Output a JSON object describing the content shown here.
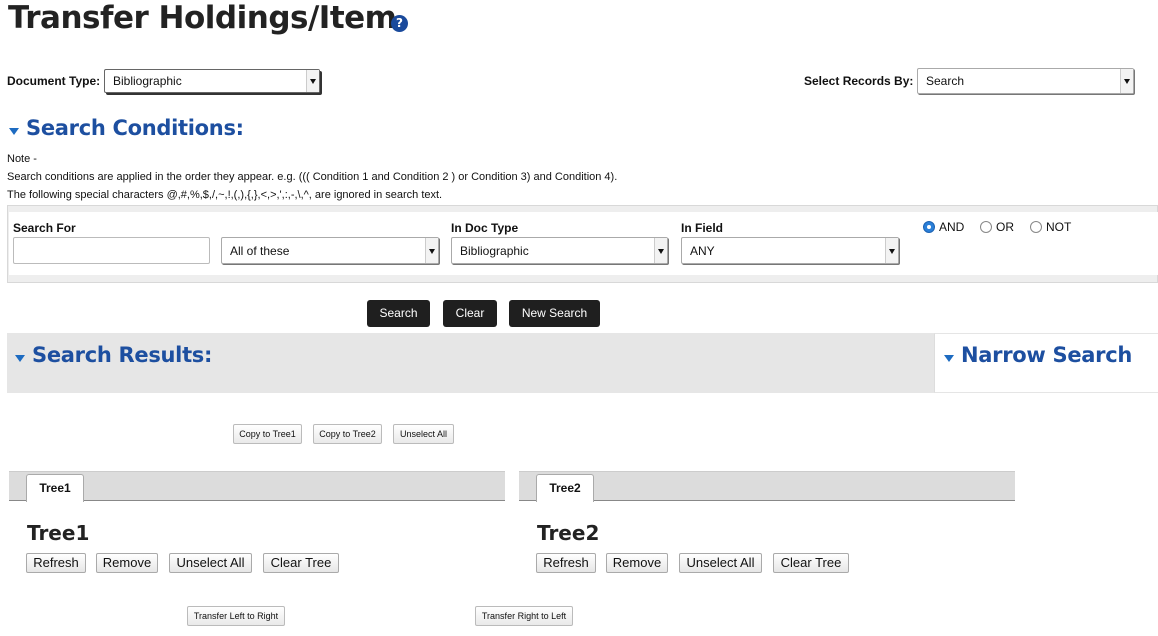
{
  "header": {
    "title": "Transfer Holdings/Item",
    "help_icon": "?"
  },
  "filters": {
    "document_type_label": "Document Type:",
    "document_type_value": "Bibliographic",
    "select_records_label": "Select Records By:",
    "select_records_value": "Search"
  },
  "search_conditions": {
    "title": "Search Conditions:",
    "note_heading": "Note -",
    "note_line1": "Search conditions are applied in the order they appear. e.g. ((( Condition 1 and Condition 2 ) or Condition 3) and Condition 4).",
    "note_line2": "The following special characters @,#,%,$,/,~,!,(,),{,},<,>,',:,-,\\,^, are ignored in search text.",
    "search_for_label": "Search For",
    "search_for_value": "",
    "match_value": "All of these",
    "doc_type_label": "In Doc Type",
    "doc_type_value": "Bibliographic",
    "field_label": "In Field",
    "field_value": "ANY",
    "operators": [
      {
        "label": "AND",
        "selected": true
      },
      {
        "label": "OR",
        "selected": false
      },
      {
        "label": "NOT",
        "selected": false
      }
    ]
  },
  "actions": {
    "search": "Search",
    "clear": "Clear",
    "new_search": "New Search"
  },
  "results": {
    "title": "Search Results:",
    "narrow_title": "Narrow Search"
  },
  "copy_actions": {
    "copy_tree1": "Copy to Tree1",
    "copy_tree2": "Copy to Tree2",
    "unselect_all": "Unselect All"
  },
  "trees": [
    {
      "tab": "Tree1",
      "title": "Tree1",
      "refresh": "Refresh",
      "remove": "Remove",
      "unselect_all": "Unselect All",
      "clear_tree": "Clear Tree"
    },
    {
      "tab": "Tree2",
      "title": "Tree2",
      "refresh": "Refresh",
      "remove": "Remove",
      "unselect_all": "Unselect All",
      "clear_tree": "Clear Tree"
    }
  ],
  "transfer": {
    "left_to_right": "Transfer Left to Right",
    "right_to_left": "Transfer Right to Left"
  },
  "colors": {
    "heading_blue": "#1d4fa0",
    "dark_button": "#1f1f1f",
    "radio_selected": "#2a7fd8"
  }
}
